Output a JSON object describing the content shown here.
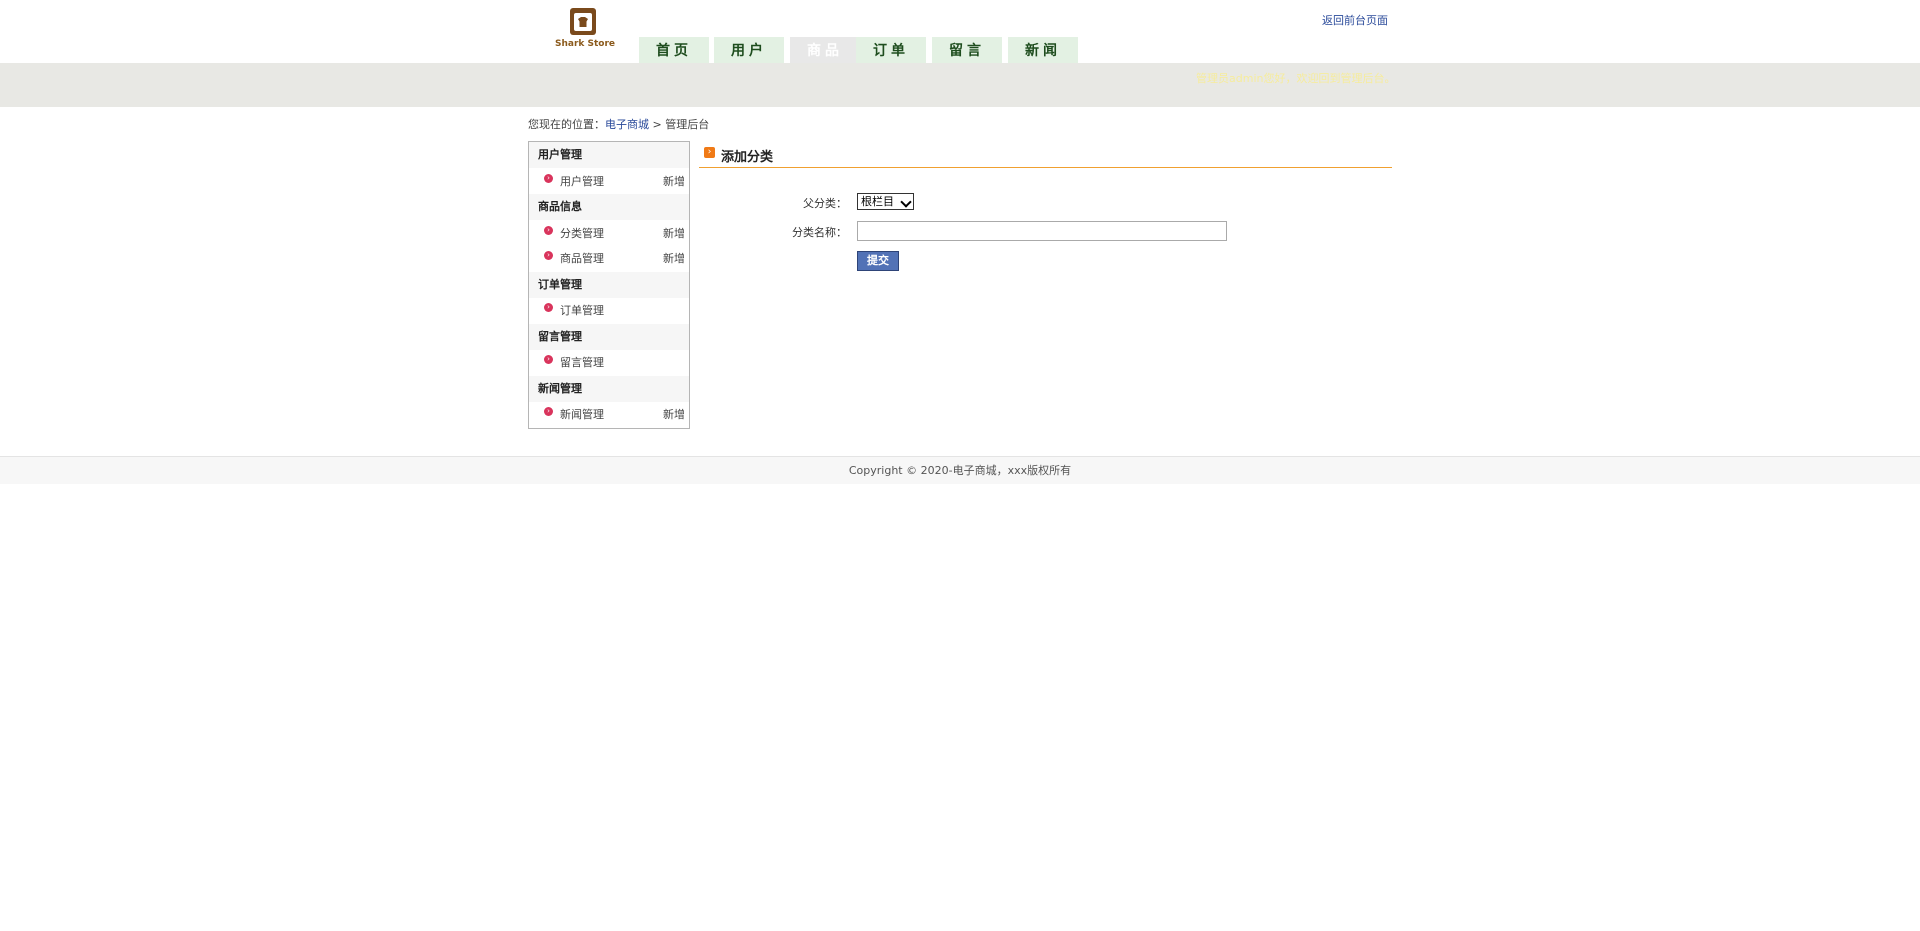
{
  "header": {
    "logo_text": "Shark Store",
    "back_link": "返回前台页面",
    "welcome": "管理员admin您好，欢迎回到管理后台。"
  },
  "nav": {
    "tabs": [
      {
        "label": "首页",
        "active": false
      },
      {
        "label": "用户",
        "active": false
      },
      {
        "label": "商品",
        "active": true
      },
      {
        "label": "订单",
        "active": false
      },
      {
        "label": "留言",
        "active": false
      },
      {
        "label": "新闻",
        "active": false
      }
    ]
  },
  "breadcrumb": {
    "prefix": "您现在的位置：",
    "link": "电子商城",
    "sep": " > ",
    "current": "管理后台"
  },
  "sidebar": {
    "groups": [
      {
        "title": "用户管理",
        "items": [
          {
            "label": "用户管理",
            "add": "新增"
          }
        ]
      },
      {
        "title": "商品信息",
        "items": [
          {
            "label": "分类管理",
            "add": "新增"
          },
          {
            "label": "商品管理",
            "add": "新增"
          }
        ]
      },
      {
        "title": "订单管理",
        "items": [
          {
            "label": "订单管理",
            "add": ""
          }
        ]
      },
      {
        "title": "留言管理",
        "items": [
          {
            "label": "留言管理",
            "add": ""
          }
        ]
      },
      {
        "title": "新闻管理",
        "items": [
          {
            "label": "新闻管理",
            "add": "新增"
          }
        ]
      }
    ]
  },
  "main": {
    "title": "添加分类",
    "parent_label": "父分类：",
    "parent_value": "根栏目",
    "name_label": "分类名称：",
    "name_value": "",
    "submit": "提交"
  },
  "footer": {
    "copyright": "Copyright © 2020-电子商城，xxx版权所有"
  },
  "colors": {
    "nav_tab_bg": "#e3f1e3",
    "nav_tab_text": "#1e4d1e",
    "banner_bg": "#e8e8e4",
    "accent_orange": "#f07a16",
    "button_blue": "#5272b6",
    "link_blue": "#2a4a9a"
  }
}
